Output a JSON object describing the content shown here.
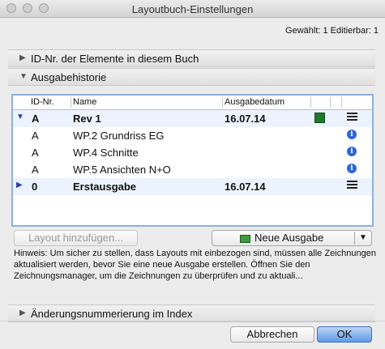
{
  "window": {
    "title": "Layoutbuch-Einstellungen"
  },
  "selection_info": "Gewählt: 1 Editierbar: 1",
  "sections": {
    "ids": "ID-Nr. der Elemente in diesem Buch",
    "history": "Ausgabehistorie",
    "index": "Änderungsnummerierung im Index"
  },
  "table": {
    "headers": {
      "id": "ID-Nr.",
      "name": "Name",
      "date": "Ausgabedatum"
    },
    "rows": [
      {
        "id": "A",
        "name": "Rev 1",
        "date": "16.07.14"
      },
      {
        "id": "A",
        "name": "WP.2 Grundriss EG",
        "date": ""
      },
      {
        "id": "A",
        "name": "WP.4 Schnitte",
        "date": ""
      },
      {
        "id": "A",
        "name": "WP.5 Ansichten N+O",
        "date": ""
      },
      {
        "id": "0",
        "name": "Erstausgabe",
        "date": "16.07.14"
      }
    ]
  },
  "buttons": {
    "add_layout": "Layout hinzufügen...",
    "new_issue": "Neue Ausgabe",
    "cancel": "Abbrechen",
    "ok": "OK"
  },
  "hint": "Hinweis: Um sicher zu stellen, dass Layouts mit einbezogen sind, müssen alle Zeichnungen aktualisiert werden, bevor Sie eine neue Ausgabe erstellen. Öffnen Sie den Zeichnungsmanager, um die Zeichnungen zu überprüfen und zu aktuali...",
  "icons": {
    "collapsed": "triangle-right-icon",
    "expanded": "triangle-down-icon",
    "info": "info-icon",
    "list": "list-icon",
    "revision": "revision-icon"
  },
  "colors": {
    "accent": "#5f9ae6",
    "selection_border": "#8fb0d9",
    "info": "#2b67d6",
    "revision": "#1f7a2e"
  }
}
